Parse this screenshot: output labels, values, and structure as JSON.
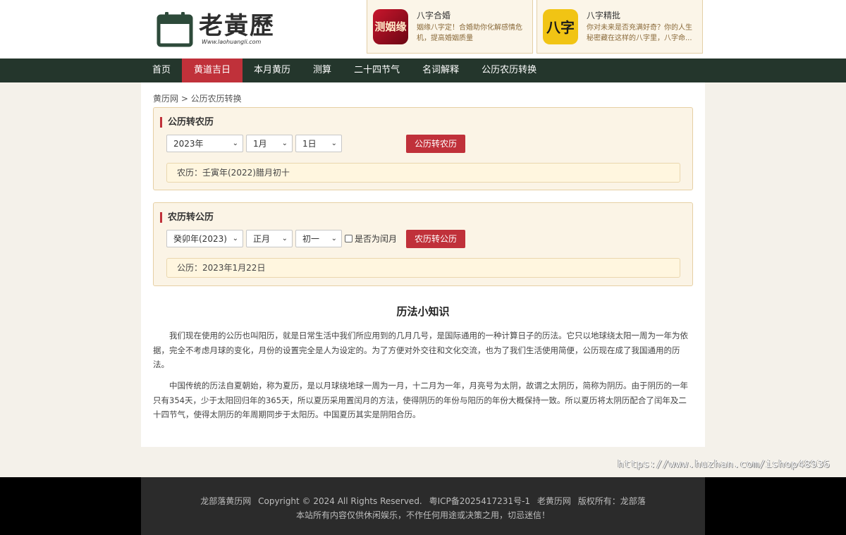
{
  "header": {
    "logo_title": "老黃歷",
    "logo_url": "Www.laohuangli.com"
  },
  "ads": [
    {
      "title": "八字合婚",
      "desc": "姻缘八字定！合婚助你化解感情危机，提高婚姻质量",
      "image_text": "测姻缘"
    },
    {
      "title": "八字精批",
      "desc": "你对未来是否充满好奇？你的人生秘密藏在这样的八字里，八字命...",
      "image_text": "八字"
    }
  ],
  "nav": {
    "items": [
      "首页",
      "黄道吉日",
      "本月黄历",
      "测算",
      "二十四节气",
      "名词解释",
      "公历农历转换"
    ],
    "active_index": 1
  },
  "breadcrumb": "黄历网 > 公历农历转换",
  "solar_to_lunar": {
    "title": "公历转农历",
    "year": "2023年",
    "month": "1月",
    "day": "1日",
    "button": "公历转农历",
    "result": "农历：壬寅年(2022)腊月初十"
  },
  "lunar_to_solar": {
    "title": "农历转公历",
    "year": "癸卯年(2023)",
    "month": "正月",
    "day": "初一",
    "leap_label": "是否为闰月",
    "leap_checked": false,
    "button": "农历转公历",
    "result": "公历：2023年1月22日"
  },
  "knowledge": {
    "title": "历法小知识",
    "paragraphs": [
      "我们现在使用的公历也叫阳历，就是日常生活中我们所应用到的几月几号，是国际通用的一种计算日子的历法。它只以地球绕太阳一周为一年为依据，完全不考虑月球的变化，月份的设置完全是人为设定的。为了方便对外交往和文化交流，也为了我们生活使用简便，公历现在成了我国通用的历法。",
      "中国传统的历法自夏朝始，称为夏历，是以月球绕地球一周为一月，十二月为一年，月亮号为太阴，故谓之太阴历，简称为阴历。由于阴历的一年只有354天，少于太阳回归年的365天，所以夏历采用置闰月的方法，使得阴历的年份与阳历的年份大概保持一致。所以夏历将太阴历配合了闰年及二十四节气，使得太阴历的年周期同步于太阳历。中国夏历其实是阴阳合历。"
    ]
  },
  "watermark": "https://www.huzhan.com/ishop48936",
  "footer": {
    "line1": [
      "龙部落黄历网",
      "Copyright © 2024 All Rights Reserved.",
      "粤ICP备2025417231号-1",
      "老黄历网",
      "版权所有：龙部落"
    ],
    "line2": "本站所有内容仅供休闲娱乐，不作任何用途或决策之用，切忌迷信！"
  },
  "colors": {
    "nav_bg": "#24362c",
    "accent": "#c0313a",
    "panel_bg": "#fbf4e6"
  }
}
